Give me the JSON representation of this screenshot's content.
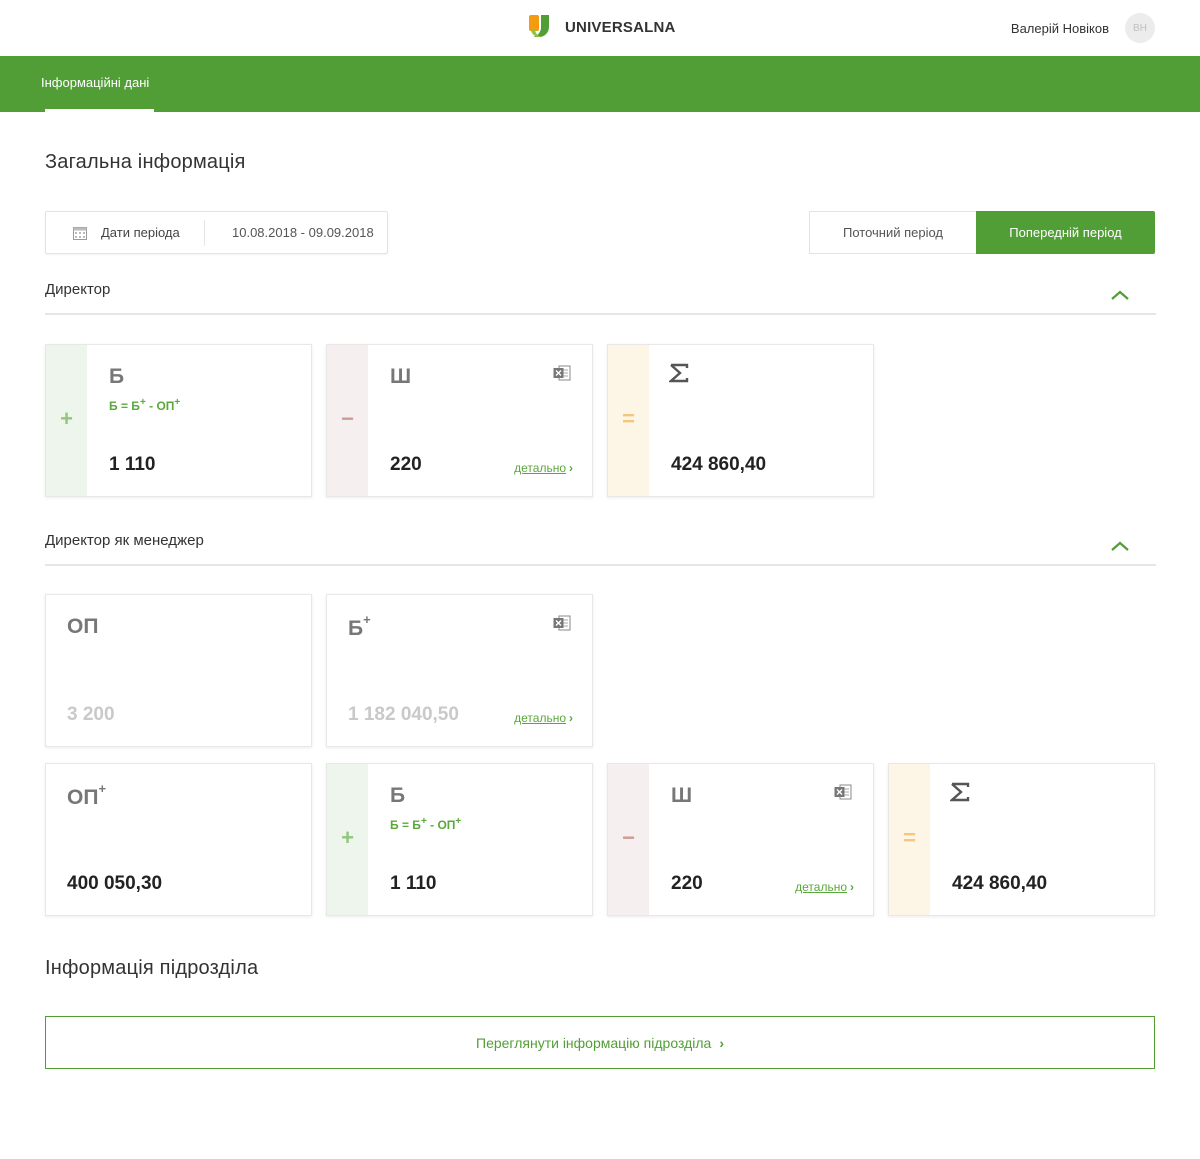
{
  "header": {
    "brand": "UNIVERSALNA",
    "user_name": "Валерій Новіков",
    "avatar_initials": "ВН",
    "brand_colors": {
      "orange": "#f39c12",
      "green": "#529e36"
    }
  },
  "nav": {
    "tabs": [
      {
        "label": "Інформаційні дані",
        "active": true
      }
    ]
  },
  "general": {
    "title": "Загальна інформація",
    "date_label": "Дати періода",
    "date_value": "10.08.2018 - 09.09.2018",
    "period_current": "Поточний період",
    "period_previous": "Попередній період",
    "active_period": "previous"
  },
  "sections": [
    {
      "title": "Директор",
      "cards": [
        {
          "strip": "plus",
          "symbol": "+",
          "title": "Б",
          "formula_pre": "Б = Б",
          "formula_mid": " - ОП",
          "value": "1 110"
        },
        {
          "strip": "minus",
          "symbol": "−",
          "title": "Ш",
          "value": "220",
          "detail": "детально",
          "excel_icon": "excel-icon"
        },
        {
          "strip": "eq",
          "symbol": "=",
          "title": "Σ",
          "value": "424 860,40"
        }
      ]
    },
    {
      "title": "Директор як менеджер",
      "cards_row1": [
        {
          "title": "ОП",
          "value": "3 200",
          "muted": true
        },
        {
          "title": "Б",
          "title_sup": "+",
          "value": "1 182 040,50",
          "muted": true,
          "detail": "детально",
          "excel_icon": "excel-icon"
        }
      ],
      "cards_row2": [
        {
          "title": "ОП",
          "title_sup": "+",
          "value": "400 050,30"
        },
        {
          "strip": "plus",
          "symbol": "+",
          "title": "Б",
          "formula_pre": "Б = Б",
          "formula_mid": " - ОП",
          "value": "1 110"
        },
        {
          "strip": "minus",
          "symbol": "−",
          "title": "Ш",
          "value": "220",
          "detail": "детально",
          "excel_icon": "excel-icon"
        },
        {
          "strip": "eq",
          "symbol": "=",
          "title": "Σ",
          "value": "424 860,40"
        }
      ]
    }
  ],
  "subdivision": {
    "title": "Інформація підрозділа",
    "button_label": "Переглянути інформацію підрозділа"
  },
  "sup_plus": "+",
  "chevron_right": "›"
}
